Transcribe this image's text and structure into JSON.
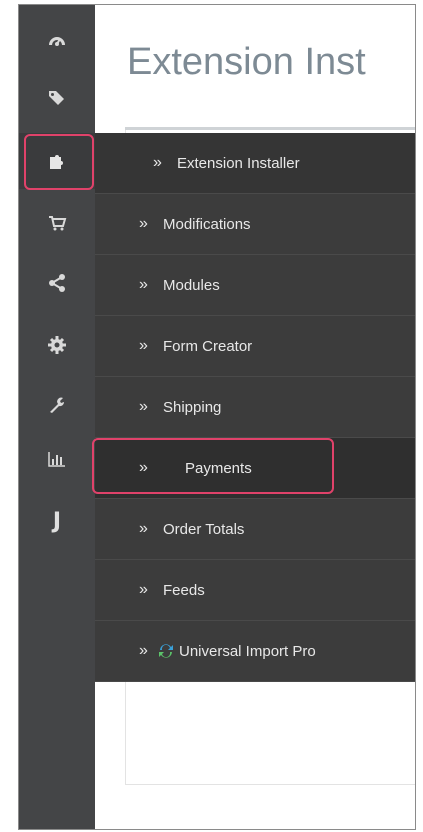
{
  "page": {
    "title": "Extension Inst"
  },
  "sidebar": {
    "icons": [
      {
        "name": "dashboard-icon"
      },
      {
        "name": "tags-icon"
      },
      {
        "name": "puzzle-icon",
        "active": true
      },
      {
        "name": "cart-icon"
      },
      {
        "name": "share-icon"
      },
      {
        "name": "gear-icon"
      },
      {
        "name": "wrench-icon"
      },
      {
        "name": "bar-chart-icon"
      },
      {
        "name": "j-logo-icon",
        "glyph": "J"
      }
    ]
  },
  "submenu": {
    "items": [
      {
        "label": "Extension Installer"
      },
      {
        "label": "Modifications"
      },
      {
        "label": "Modules"
      },
      {
        "label": "Form Creator"
      },
      {
        "label": "Shipping"
      },
      {
        "label": "Payments"
      },
      {
        "label": "Order Totals"
      },
      {
        "label": "Feeds"
      },
      {
        "label": "Universal Import Pro"
      }
    ]
  },
  "colors": {
    "highlight": "#e0426a",
    "accent_blue": "#5aa7dd",
    "sidebar_bg": "#444547",
    "submenu_bg": "#3c3c3c"
  }
}
